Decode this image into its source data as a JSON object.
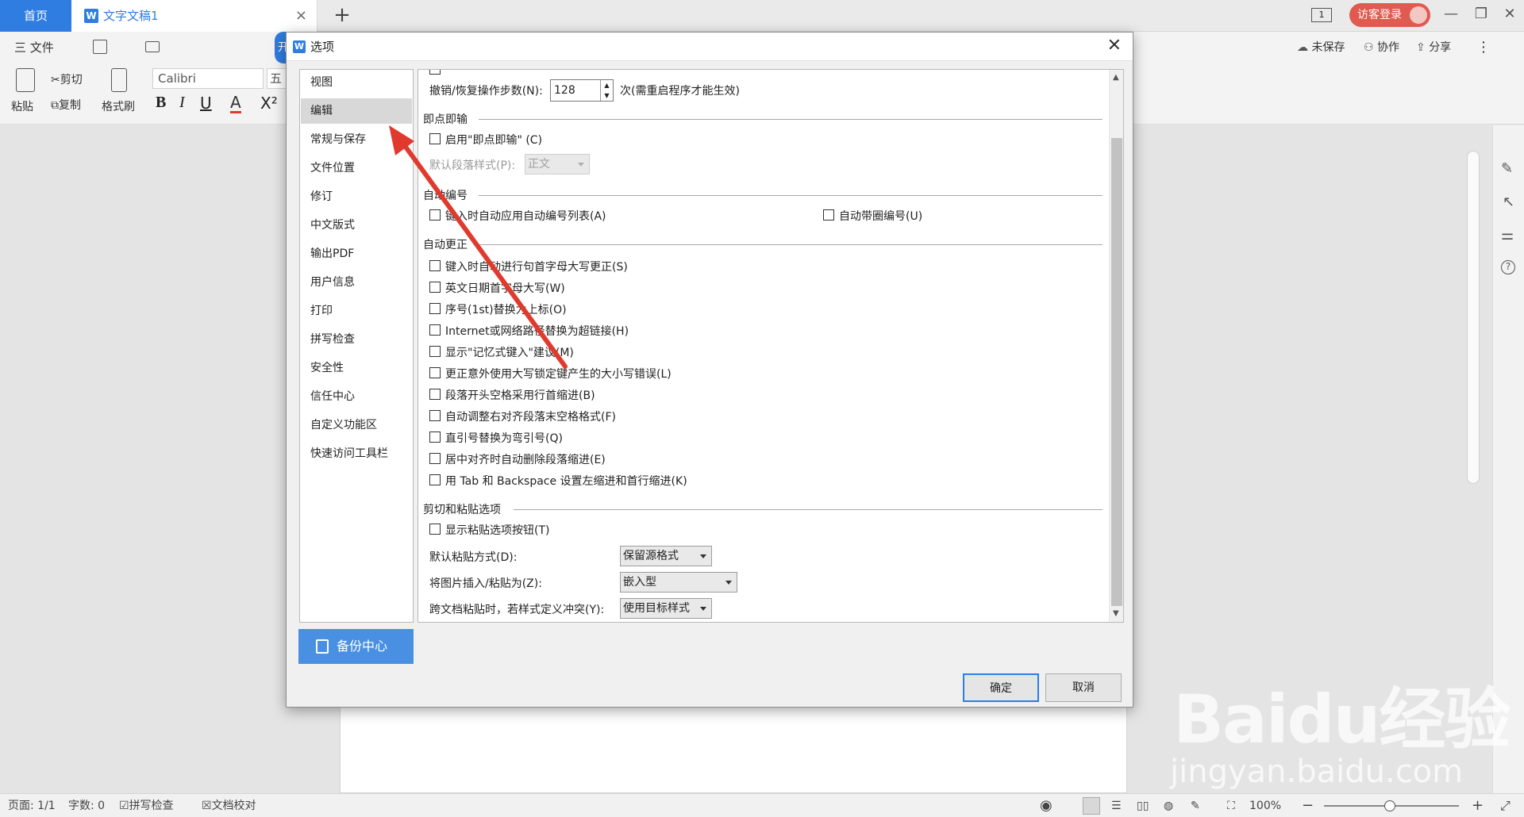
{
  "tabs": {
    "home": "首页",
    "doc_title": "文字文稿1",
    "close": "×",
    "add": "+"
  },
  "topright": {
    "page_count": "1",
    "guest": "访客登录",
    "minimize": "—",
    "restore": "❐",
    "close": "✕"
  },
  "menubar": {
    "file": "三 文件",
    "unsaved": "未保存",
    "collab": "协作",
    "share": "分享",
    "more": "⋮"
  },
  "ribbon": {
    "paste": "粘贴",
    "cut": "剪切",
    "copy": "复制",
    "format_painter": "格式刷",
    "font": "Calibri",
    "size": "五号",
    "start": "开"
  },
  "dialog": {
    "title": "选项",
    "nav": [
      "视图",
      "编辑",
      "常规与保存",
      "文件位置",
      "修订",
      "中文版式",
      "输出PDF",
      "用户信息",
      "打印",
      "拼写检查",
      "安全性",
      "信任中心",
      "自定义功能区",
      "快速访问工具栏"
    ],
    "active_nav": "编辑",
    "backup": "备份中心",
    "ok": "确定",
    "cancel": "取消",
    "content": {
      "undo_label": "撤销/恢复操作步数(N):",
      "undo_value": "128",
      "undo_suffix": "次(需重启程序才能生效)",
      "sec_click_type": "即点即输",
      "enable_click_type": "启用\"即点即输\" (C)",
      "default_para_label": "默认段落样式(P):",
      "default_para_value": "正文",
      "sec_autonum": "自动编号",
      "autonum_list": "键入时自动应用自动编号列表(A)",
      "autonum_circle": "自动带圈编号(U)",
      "sec_autocorrect": "自动更正",
      "autocorrect": [
        "键入时自动进行句首字母大写更正(S)",
        "英文日期首字母大写(W)",
        "序号(1st)替换为上标(O)",
        "Internet或网络路径替换为超链接(H)",
        "显示\"记忆式键入\"建议(M)",
        "更正意外使用大写锁定键产生的大小写错误(L)",
        "段落开头空格采用行首缩进(B)",
        "自动调整右对齐段落末空格格式(F)",
        "直引号替换为弯引号(Q)",
        "居中对齐时自动删除段落缩进(E)",
        "用 Tab 和 Backspace 设置左缩进和首行缩进(K)"
      ],
      "sec_paste": "剪切和粘贴选项",
      "show_paste_btn": "显示粘贴选项按钮(T)",
      "paste_default_label": "默认粘贴方式(D):",
      "paste_default_value": "保留源格式",
      "paste_image_label": "将图片插入/粘贴为(Z):",
      "paste_image_value": "嵌入型",
      "cross_doc_label": "跨文档粘贴时，若样式定义冲突(Y):",
      "cross_doc_value": "使用目标样式"
    }
  },
  "statusbar": {
    "page": "页面: 1/1",
    "words": "字数: 0",
    "spell": "拼写检查",
    "proof": "文档校对",
    "zoom": "100%"
  },
  "watermark": {
    "brand": "Baidu经验",
    "url": "jingyan.baidu.com"
  },
  "colors": {
    "accent": "#2f7de1",
    "guest": "#e05a4f",
    "arrow": "#e03a2e"
  }
}
